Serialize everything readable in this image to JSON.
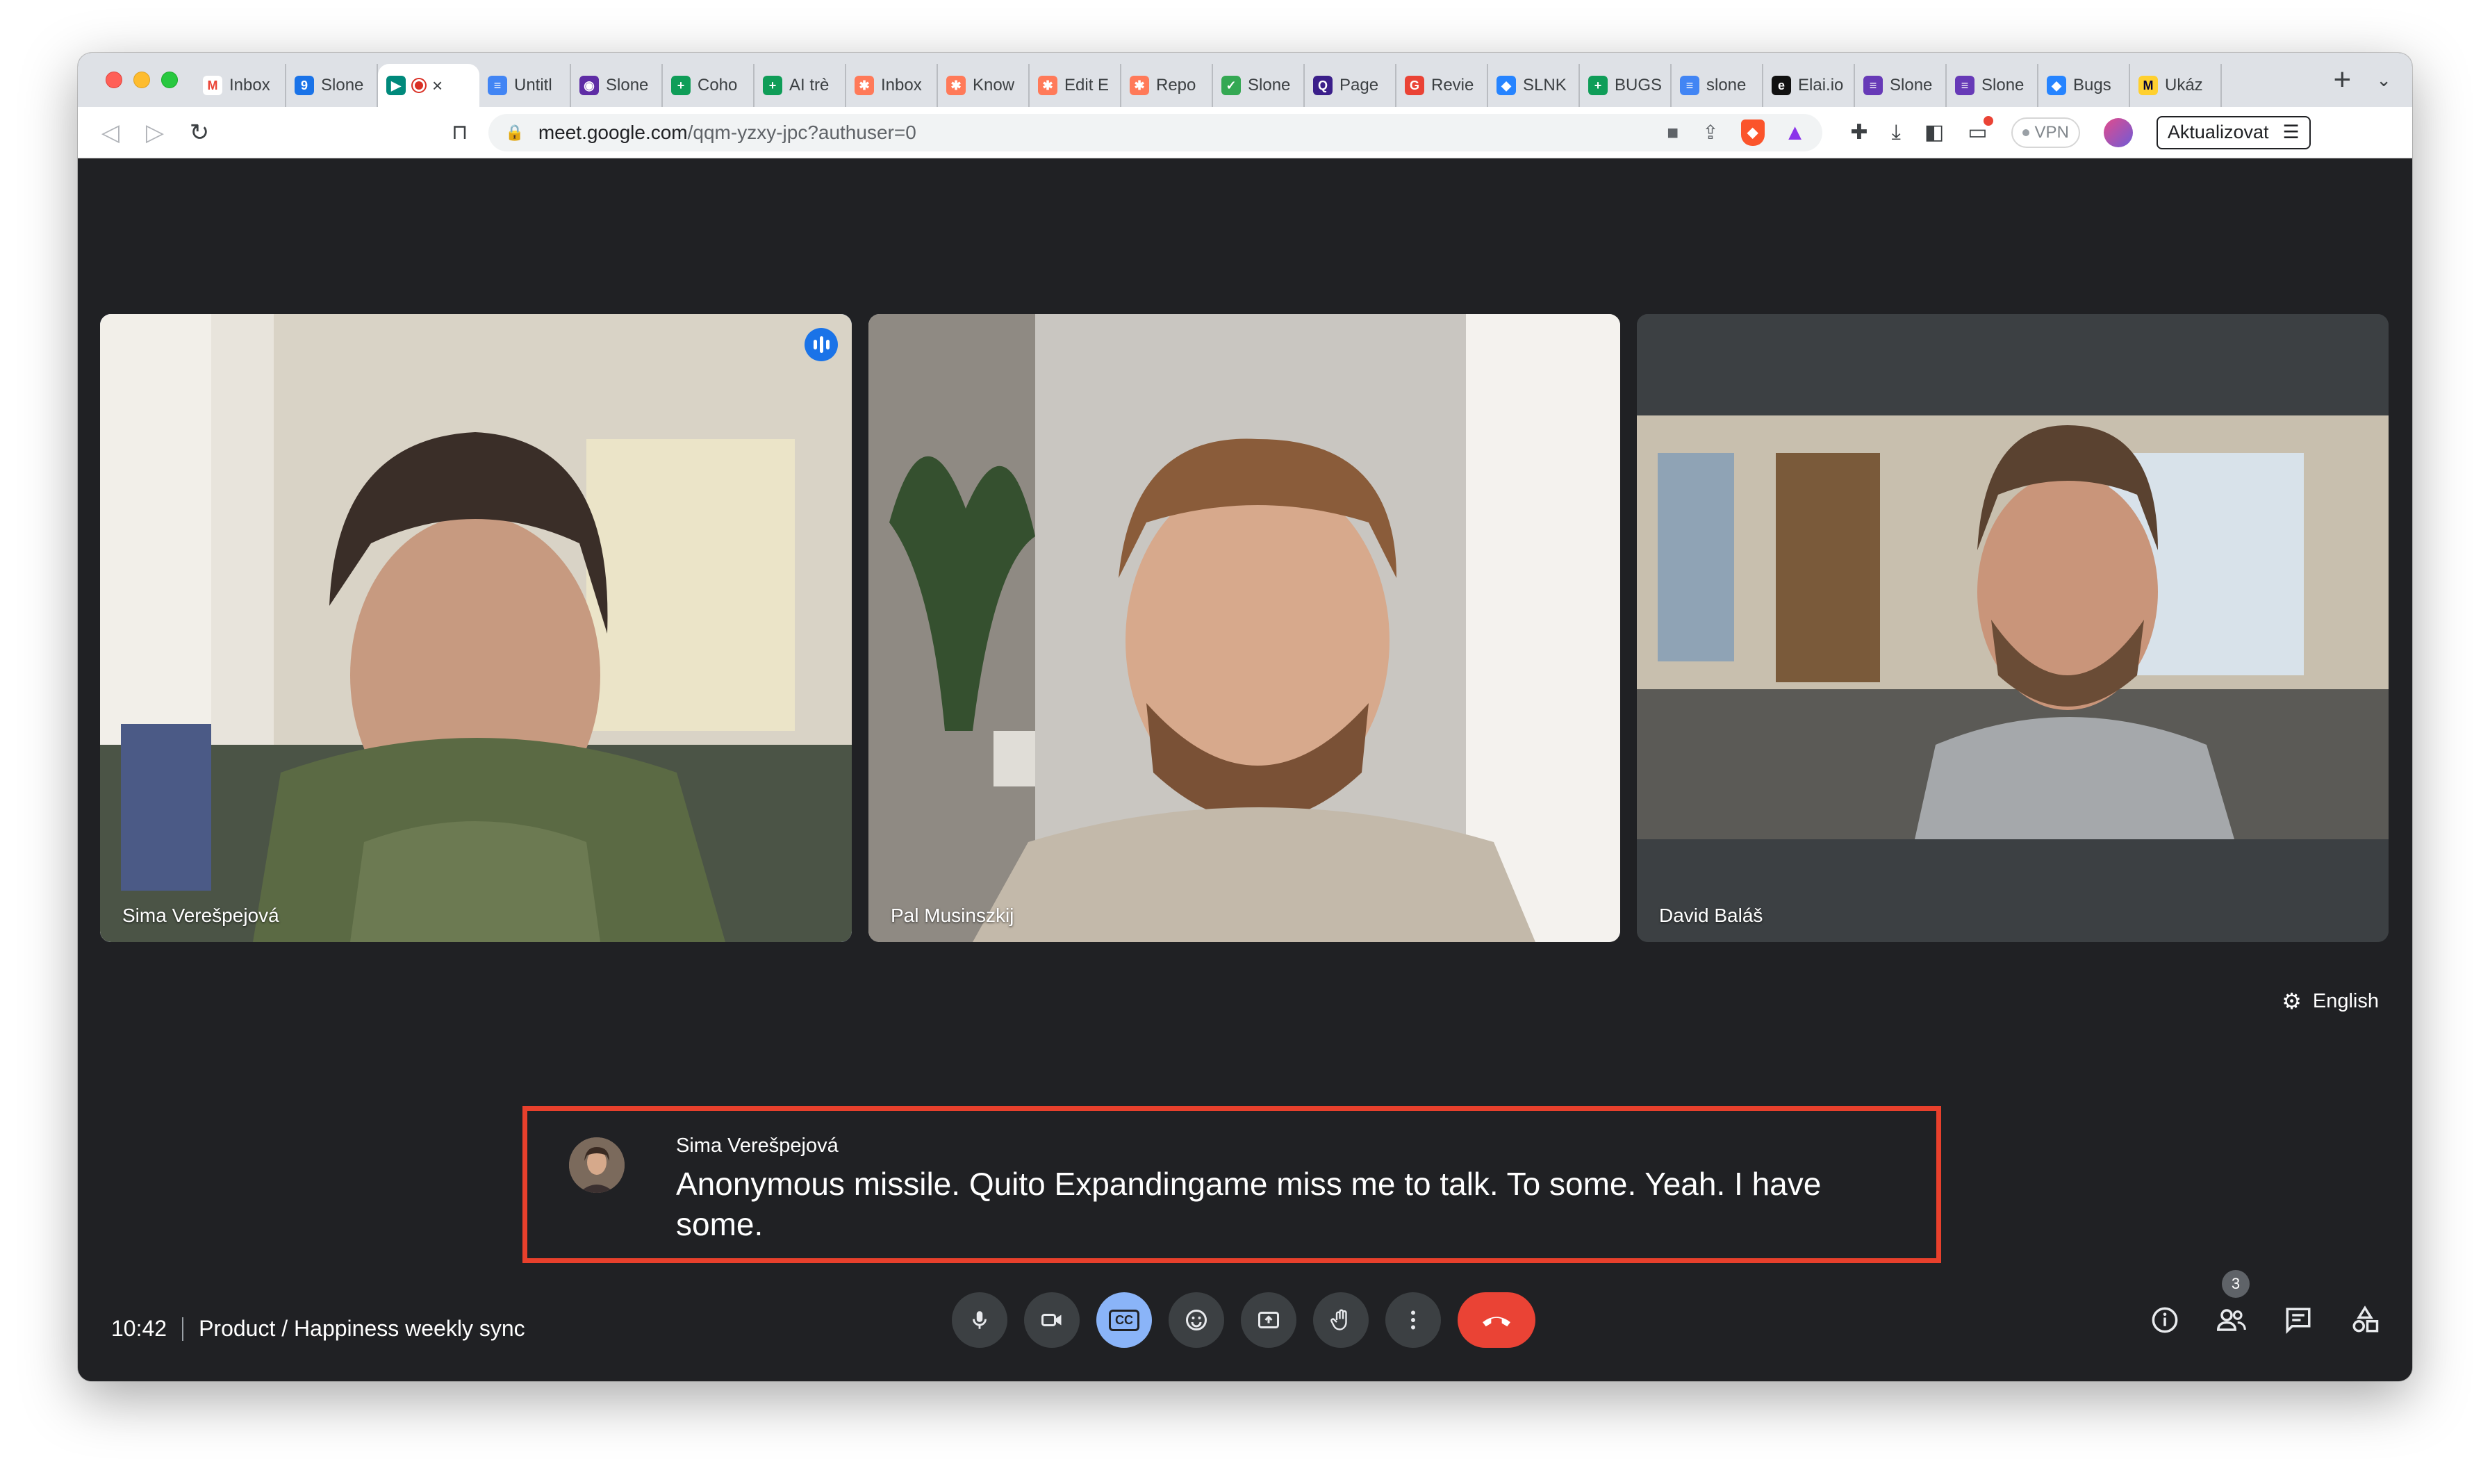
{
  "browser": {
    "tabs": [
      {
        "title": "Inbox",
        "favicon": "gmail-icon",
        "color": "#ffffff",
        "glyph": "M",
        "glyph_color": "#ea4335"
      },
      {
        "title": "Slone",
        "favicon": "calendar-icon",
        "color": "#1a73e8",
        "glyph": "9"
      },
      {
        "title": "",
        "favicon": "meet-icon",
        "color": "#00897b",
        "glyph": "▶",
        "active": true
      },
      {
        "title": "Untitl",
        "favicon": "docs-icon",
        "color": "#4285f4",
        "glyph": "≡"
      },
      {
        "title": "Slone",
        "favicon": "linear-icon",
        "color": "#5e2ca5",
        "glyph": "◉"
      },
      {
        "title": "Coho",
        "favicon": "sheets-icon",
        "color": "#0f9d58",
        "glyph": "+"
      },
      {
        "title": "AI trè",
        "favicon": "sheets-icon",
        "color": "#0f9d58",
        "glyph": "+"
      },
      {
        "title": "Inbox",
        "favicon": "hubspot-icon",
        "color": "#ff7a59",
        "glyph": "✱"
      },
      {
        "title": "Know",
        "favicon": "hubspot-icon",
        "color": "#ff7a59",
        "glyph": "✱"
      },
      {
        "title": "Edit E",
        "favicon": "hubspot-icon",
        "color": "#ff7a59",
        "glyph": "✱"
      },
      {
        "title": "Repo",
        "favicon": "hubspot-icon",
        "color": "#ff7a59",
        "glyph": "✱"
      },
      {
        "title": "Slone",
        "favicon": "checkmark-icon",
        "color": "#34a853",
        "glyph": "✓"
      },
      {
        "title": "Page",
        "favicon": "q-icon",
        "color": "#3b1f8a",
        "glyph": "Q"
      },
      {
        "title": "Revie",
        "favicon": "grammarly-icon",
        "color": "#ea4335",
        "glyph": "G"
      },
      {
        "title": "SLNK",
        "favicon": "jira-icon",
        "color": "#2684ff",
        "glyph": "◆"
      },
      {
        "title": "BUGS",
        "favicon": "sheets-icon",
        "color": "#0f9d58",
        "glyph": "+"
      },
      {
        "title": "slone",
        "favicon": "docs-icon",
        "color": "#4285f4",
        "glyph": "≡"
      },
      {
        "title": "Elai.io",
        "favicon": "elai-icon",
        "color": "#111111",
        "glyph": "e"
      },
      {
        "title": "Slone",
        "favicon": "forms-icon",
        "color": "#673ab7",
        "glyph": "≡"
      },
      {
        "title": "Slone",
        "favicon": "forms-icon",
        "color": "#673ab7",
        "glyph": "≡"
      },
      {
        "title": "Bugs",
        "favicon": "jira-icon",
        "color": "#2684ff",
        "glyph": "◆"
      },
      {
        "title": "Ukáz",
        "favicon": "miro-icon",
        "color": "#ffd02f",
        "glyph": "M",
        "glyph_color": "#050038"
      }
    ],
    "url_host": "meet.google.com",
    "url_path": "/qqm-yzxy-jpc?authuser=0",
    "vpn_label": "VPN",
    "update_label": "Aktualizovat"
  },
  "meet": {
    "participants": [
      {
        "name": "Sima Verešpejová",
        "speaking": true
      },
      {
        "name": "Pal Musinszkij",
        "speaking": false
      },
      {
        "name": "David Baláš",
        "speaking": false
      }
    ],
    "caption_language": "English",
    "caption": {
      "speaker": "Sima Verešpejová",
      "text": "Anonymous missile. Quito Expandingame miss me to talk. To some. Yeah. I have some."
    },
    "time": "10:42",
    "meeting_title": "Product / Happiness weekly sync",
    "participant_count": "3",
    "highlight_color": "#e8402c",
    "end_call_color": "#ea4335",
    "cc_active_color": "#8ab4f8"
  }
}
